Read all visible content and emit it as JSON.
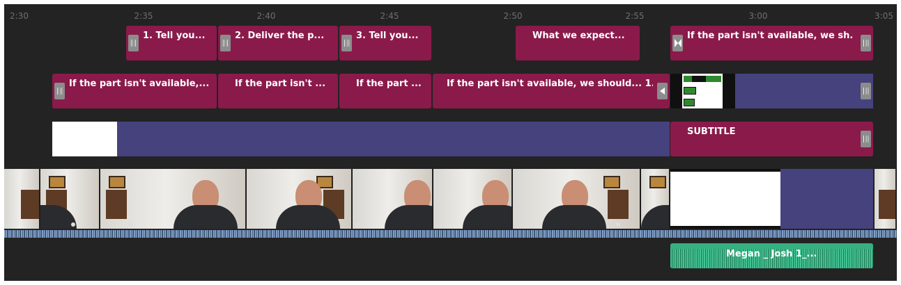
{
  "ruler": {
    "ticks": [
      "2:30",
      "2:35",
      "2:40",
      "2:45",
      "2:50",
      "2:55",
      "3:00",
      "3:05"
    ]
  },
  "track1": {
    "clips": [
      "1. Tell you...",
      "2. Deliver the p...",
      "3. Tell you...",
      "What we expect...",
      "If the part isn't available, we sh..."
    ]
  },
  "track2": {
    "clips": [
      "If the part isn't available,...",
      "If the part isn't ...",
      "If the part ...",
      "If the part isn't available, we should... 1. ..."
    ]
  },
  "track3": {
    "clip": "SUBTITLE"
  },
  "audio_track": {
    "clip": "Megan _ Josh 1_..."
  },
  "colors": {
    "timeline_bg": "#232323",
    "caption_clip": "#8a1a4a",
    "placeholder_blue": "#46427e",
    "audio_clip": "#36b081",
    "waveform": "#7f9ec9"
  },
  "icons": [
    "trim-handle-icon",
    "transition-icon",
    "collapse-arrow-icon",
    "waveform-icon"
  ]
}
